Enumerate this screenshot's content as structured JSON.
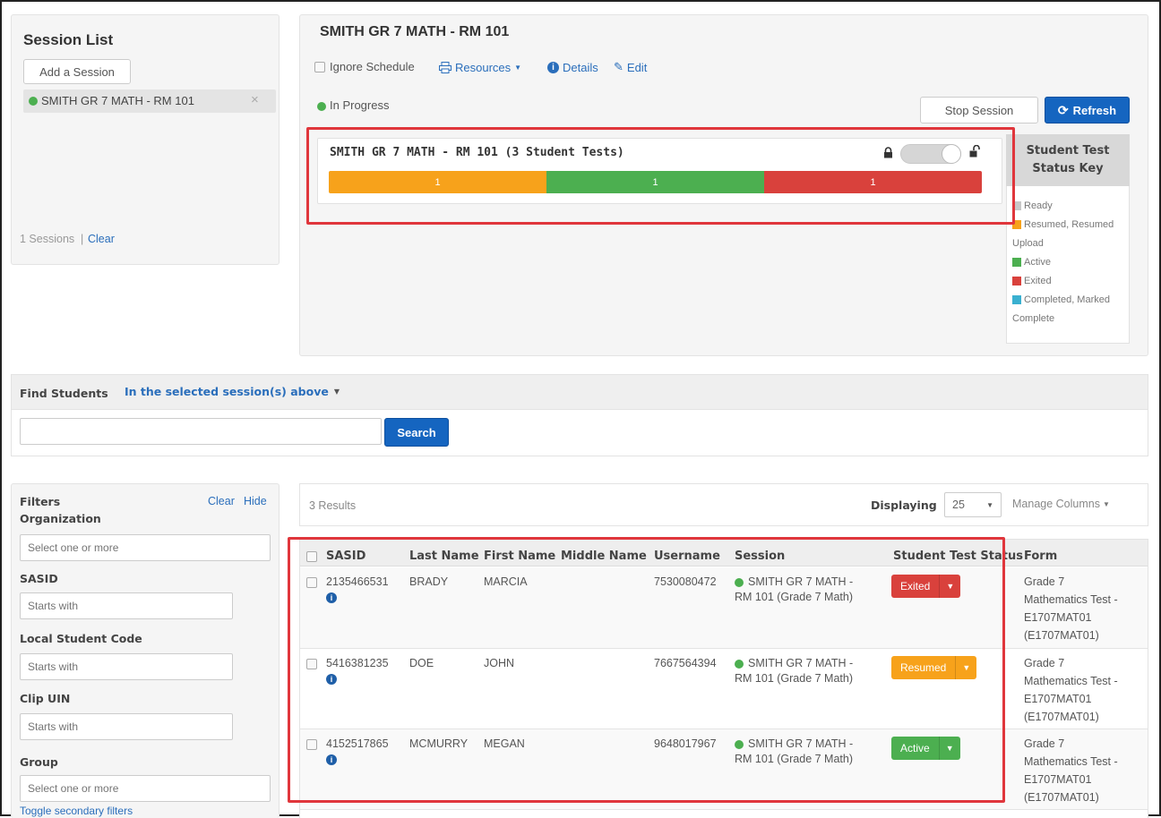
{
  "session_list": {
    "title": "Session List",
    "add_label": "Add a Session",
    "item_label": "SMITH GR 7 MATH - RM 101",
    "remove_glyph": "×",
    "count_label": "1 Sessions",
    "separator": "|",
    "clear_label": "Clear"
  },
  "session": {
    "title": "SMITH GR 7 MATH - RM 101",
    "ignore_schedule": "Ignore Schedule",
    "resources": "Resources",
    "details": "Details",
    "edit": "Edit",
    "status": "In Progress",
    "stop_label": "Stop Session",
    "refresh_label": "Refresh",
    "card_title": "SMITH GR 7 MATH - RM 101 (3 Student Tests)",
    "progress": [
      {
        "label": "1",
        "value": 1,
        "color": "#f7a21b"
      },
      {
        "label": "1",
        "value": 1,
        "color": "#4caf50"
      },
      {
        "label": "1",
        "value": 1,
        "color": "#d9413c"
      }
    ]
  },
  "status_key": {
    "title": "Student Test Status Key",
    "items": [
      {
        "label": "Ready",
        "color": "#c8c8c8"
      },
      {
        "label": "Resumed, Resumed Upload",
        "color": "#f7a21b"
      },
      {
        "label": "Active",
        "color": "#4caf50"
      },
      {
        "label": "Exited",
        "color": "#d9413c"
      },
      {
        "label": "Completed, Marked Complete",
        "color": "#3ab0d0"
      }
    ]
  },
  "find": {
    "label": "Find Students",
    "scope": "In the selected session(s) above",
    "search_label": "Search",
    "value": ""
  },
  "filters": {
    "title": "Filters",
    "clear": "Clear",
    "hide": "Hide",
    "organization": "Organization",
    "org_placeholder": "Select one or more",
    "sasid": "SASID",
    "sasid_placeholder": "Starts with",
    "local_code": "Local Student Code",
    "local_placeholder": "Starts with",
    "clip": "Clip UIN",
    "clip_placeholder": "Starts with",
    "group": "Group",
    "group_placeholder": "Select one or more",
    "toggle": "Toggle secondary filters"
  },
  "results": {
    "count": "3 Results",
    "displaying": "Displaying",
    "per_page": "25",
    "manage": "Manage Columns"
  },
  "table": {
    "headers": [
      "SASID",
      "Last Name",
      "First Name",
      "Middle Name",
      "Username",
      "Session",
      "Student Test Status",
      "Form"
    ],
    "rows": [
      {
        "sasid": "2135466531",
        "last": "BRADY",
        "first": "MARCIA",
        "middle": "",
        "username": "7530080472",
        "session1": "SMITH GR 7 MATH -",
        "session2": "RM 101 (Grade 7 Math)",
        "status": "Exited",
        "status_color": "#d9413c",
        "form": [
          "Grade 7",
          "Mathematics Test -",
          "E1707MAT01",
          "(E1707MAT01)"
        ]
      },
      {
        "sasid": "5416381235",
        "last": "DOE",
        "first": "JOHN",
        "middle": "",
        "username": "7667564394",
        "session1": "SMITH GR 7 MATH -",
        "session2": "RM 101 (Grade 7 Math)",
        "status": "Resumed",
        "status_color": "#f7a21b",
        "form": [
          "Grade 7",
          "Mathematics Test -",
          "E1707MAT01",
          "(E1707MAT01)"
        ]
      },
      {
        "sasid": "4152517865",
        "last": "MCMURRY",
        "first": "MEGAN",
        "middle": "",
        "username": "9648017967",
        "session1": "SMITH GR 7 MATH -",
        "session2": "RM 101 (Grade 7 Math)",
        "status": "Active",
        "status_color": "#4caf50",
        "form": [
          "Grade 7",
          "Mathematics Test -",
          "E1707MAT01",
          "(E1707MAT01)"
        ]
      }
    ]
  }
}
